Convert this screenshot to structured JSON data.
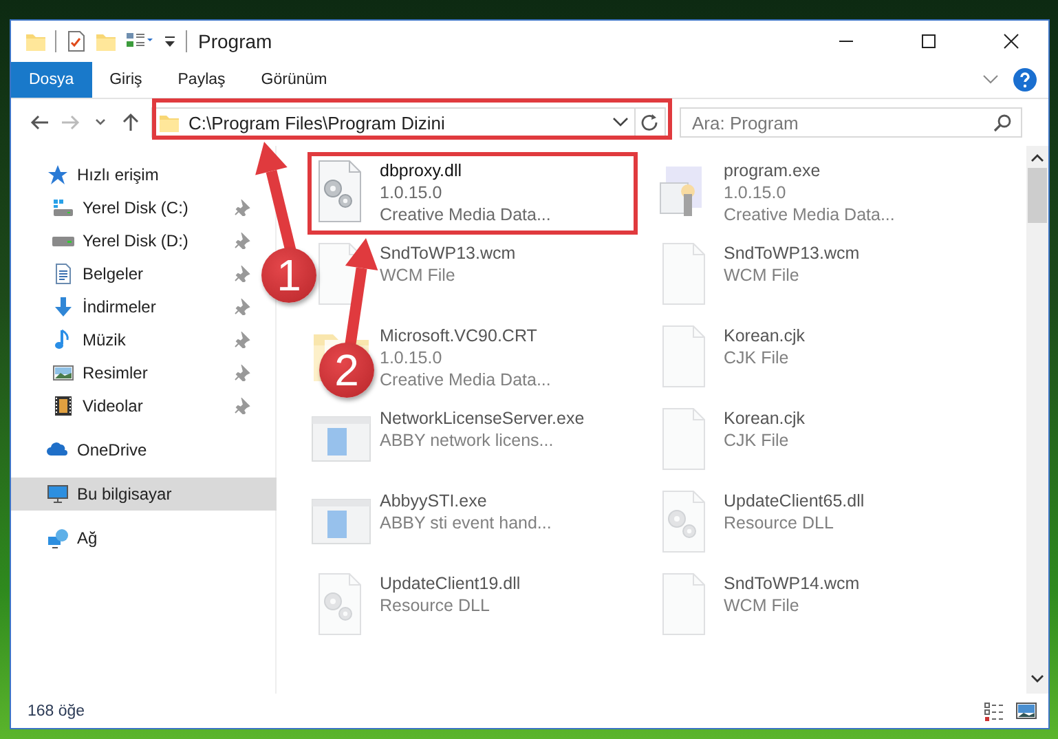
{
  "window": {
    "title": "Program"
  },
  "ribbon_tabs": [
    {
      "label": "Dosya",
      "selected": true
    },
    {
      "label": "Giriş",
      "selected": false
    },
    {
      "label": "Paylaş",
      "selected": false
    },
    {
      "label": "Görünüm",
      "selected": false
    }
  ],
  "address": {
    "path": "C:\\Program Files\\Program Dizini"
  },
  "search": {
    "placeholder": "Ara: Program"
  },
  "sidebar": {
    "items": [
      {
        "label": "Hızlı erişim",
        "kind": "star",
        "selected": false,
        "pinned": false,
        "children": [
          {
            "label": "Yerel Disk (C:)",
            "kind": "system-drive",
            "selected": false,
            "pinned": true
          },
          {
            "label": "Yerel Disk (D:)",
            "kind": "drive",
            "selected": false,
            "pinned": true
          },
          {
            "label": "Belgeler",
            "kind": "document",
            "selected": false,
            "pinned": true
          },
          {
            "label": "İndirmeler",
            "kind": "download",
            "selected": false,
            "pinned": true
          },
          {
            "label": "Müzik",
            "kind": "music",
            "selected": false,
            "pinned": true
          },
          {
            "label": "Resimler",
            "kind": "picture",
            "selected": false,
            "pinned": true
          },
          {
            "label": "Videolar",
            "kind": "video",
            "selected": false,
            "pinned": true
          }
        ]
      },
      {
        "label": "OneDrive",
        "kind": "cloud",
        "selected": false,
        "pinned": false
      },
      {
        "label": "Bu bilgisayar",
        "kind": "computer",
        "selected": true,
        "pinned": false
      },
      {
        "label": "Ağ",
        "kind": "network",
        "selected": false,
        "pinned": false
      }
    ]
  },
  "files": [
    {
      "name": "dbproxy.dll",
      "details": [
        "1.0.15.0",
        "Creative Media Data..."
      ],
      "kind": "dll",
      "blurred": false
    },
    {
      "name": "program.exe",
      "details": [
        "1.0.15.0",
        "Creative Media Data..."
      ],
      "kind": "app",
      "blurred": true
    },
    {
      "name": "SndToWP13.wcm",
      "details": [
        "WCM File"
      ],
      "kind": "blank",
      "blurred": true
    },
    {
      "name": "SndToWP13.wcm",
      "details": [
        "WCM File"
      ],
      "kind": "blank",
      "blurred": true
    },
    {
      "name": "Microsoft.VC90.CRT",
      "details": [
        "1.0.15.0",
        "Creative Media Data..."
      ],
      "kind": "folder",
      "blurred": true
    },
    {
      "name": "Korean.cjk",
      "details": [
        "CJK File"
      ],
      "kind": "blank",
      "blurred": true
    },
    {
      "name": "NetworkLicenseServer.exe",
      "details": [
        "ABBY network licens..."
      ],
      "kind": "window",
      "blurred": true
    },
    {
      "name": "Korean.cjk",
      "details": [
        "CJK File"
      ],
      "kind": "blank",
      "blurred": true
    },
    {
      "name": "AbbyySTI.exe",
      "details": [
        "ABBY sti event hand..."
      ],
      "kind": "window",
      "blurred": true
    },
    {
      "name": "UpdateClient65.dll",
      "details": [
        "Resource DLL"
      ],
      "kind": "dll",
      "blurred": true
    },
    {
      "name": "UpdateClient19.dll",
      "details": [
        "Resource DLL"
      ],
      "kind": "dll",
      "blurred": true
    },
    {
      "name": "SndToWP14.wcm",
      "details": [
        "WCM File"
      ],
      "kind": "blank",
      "blurred": true
    }
  ],
  "status_bar": {
    "count": "168 öğe"
  },
  "annotations": [
    {
      "number": "1"
    },
    {
      "number": "2"
    }
  ]
}
